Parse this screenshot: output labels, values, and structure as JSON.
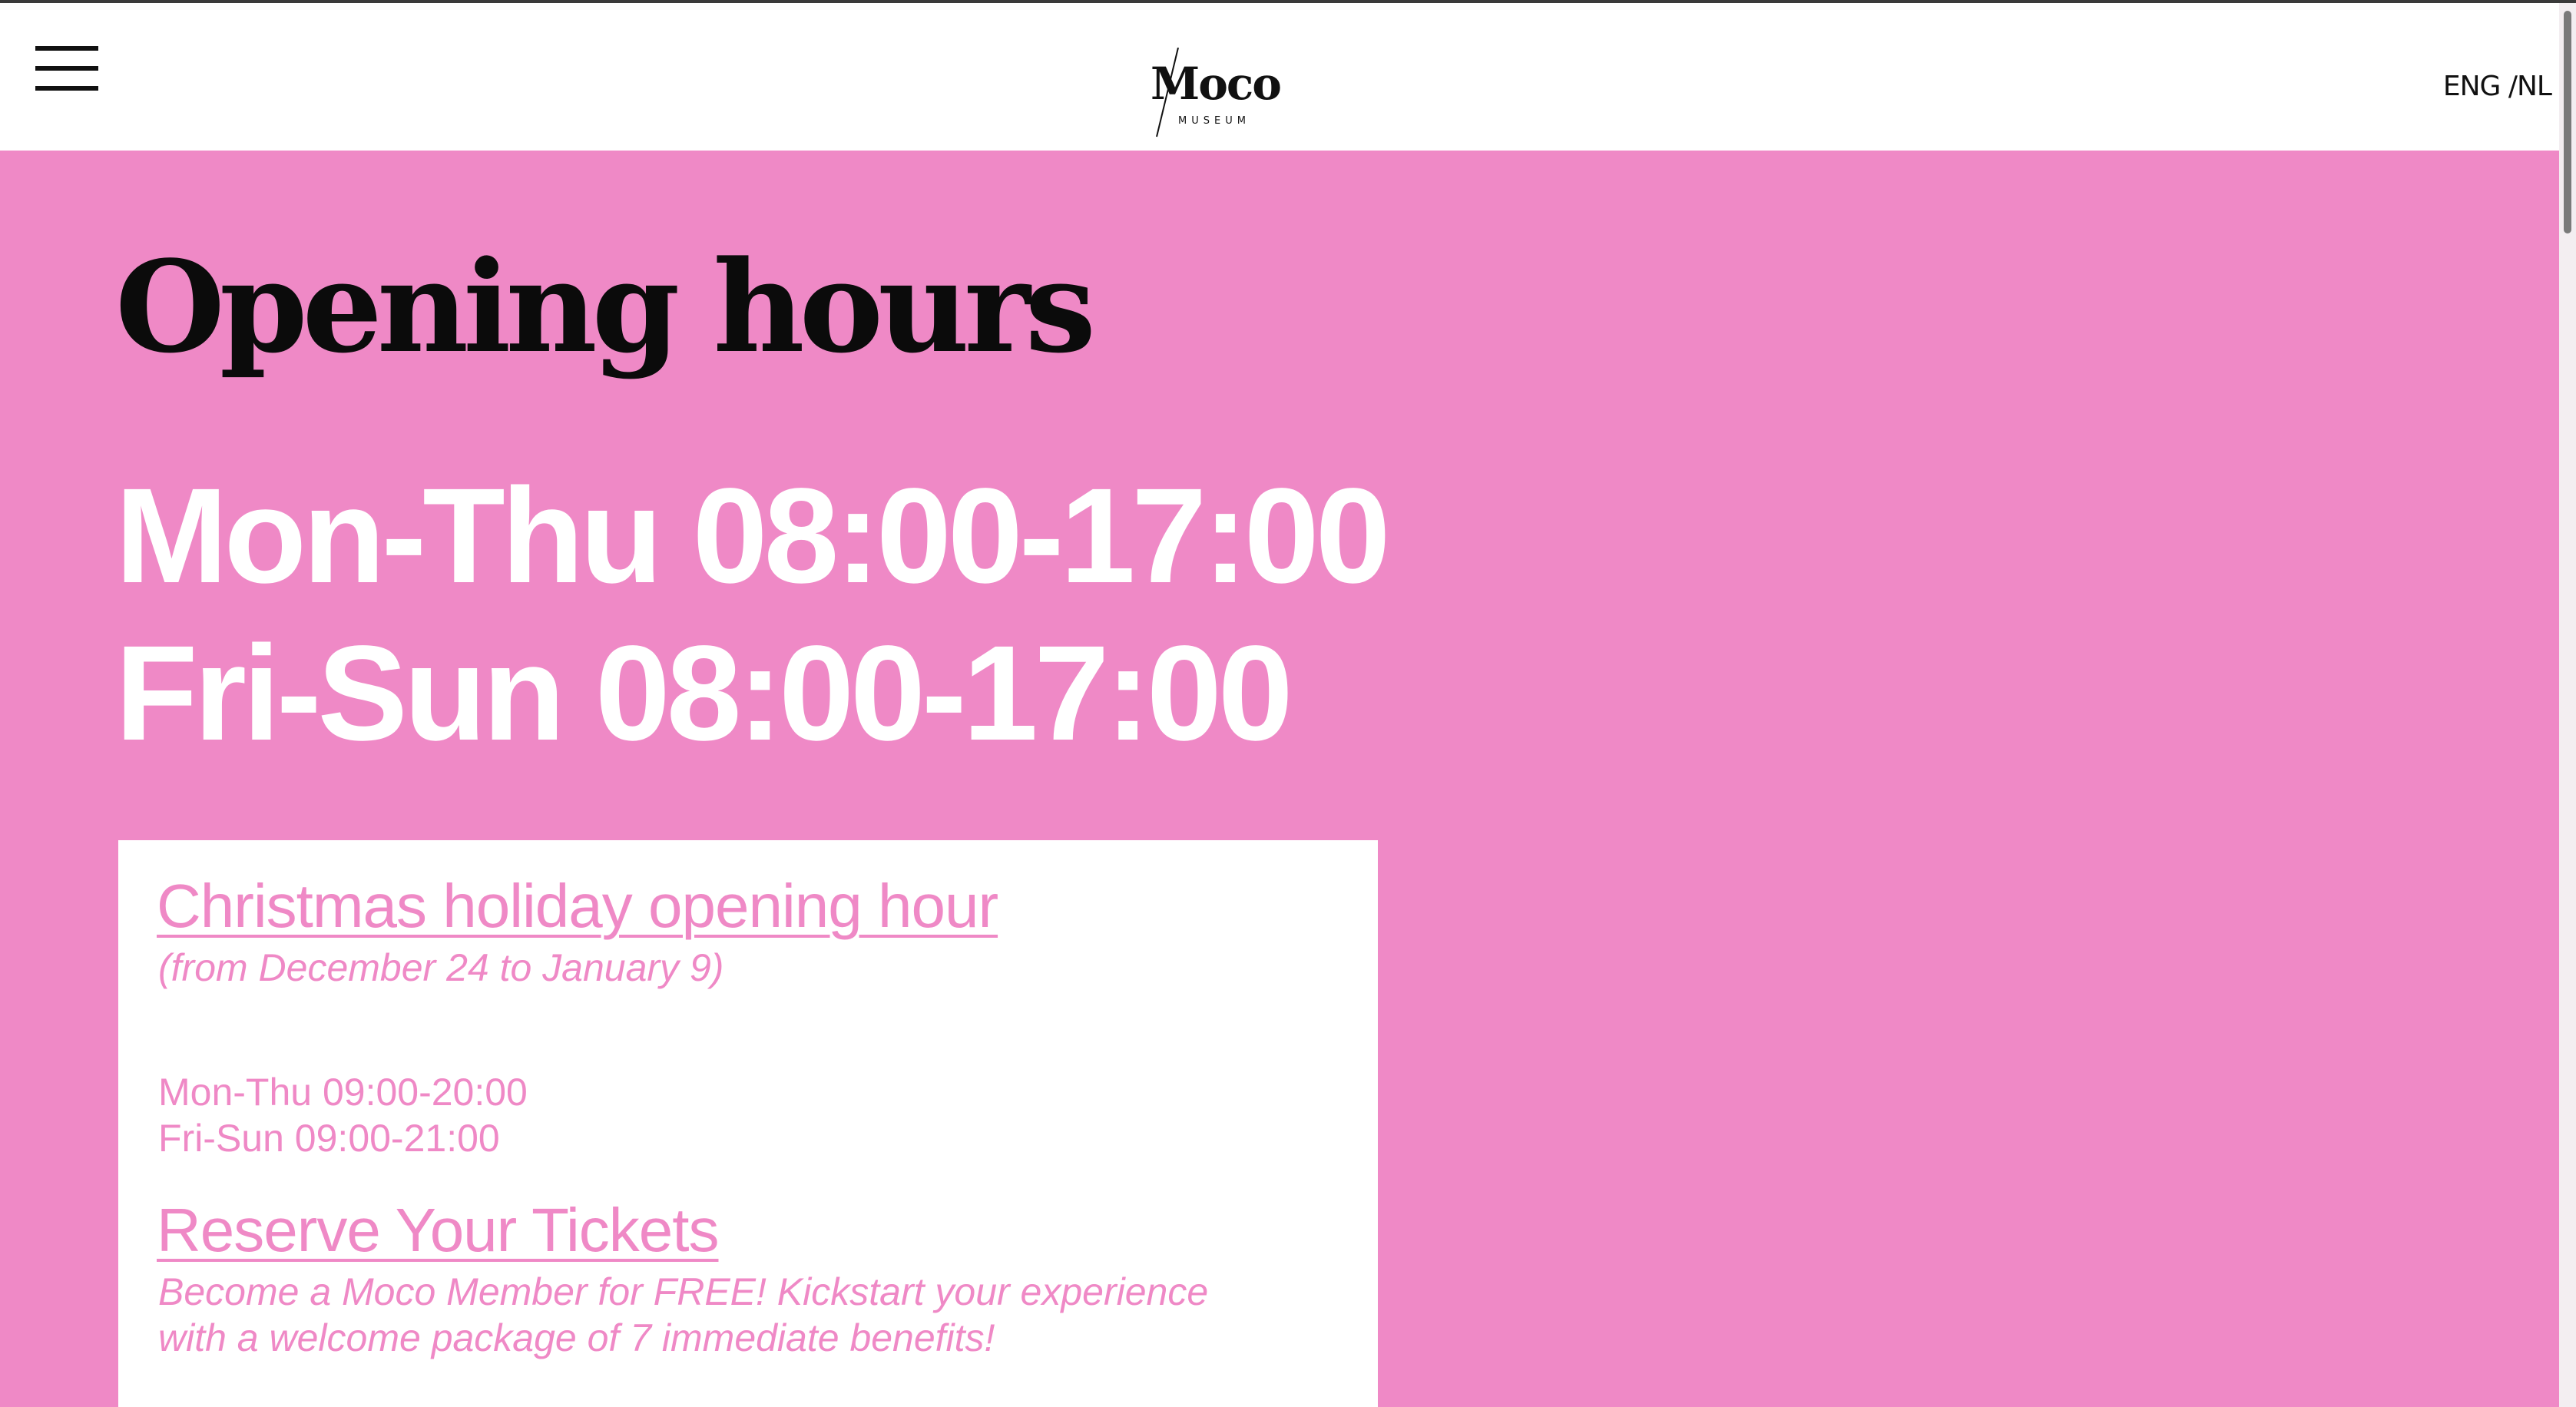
{
  "header": {
    "menu_icon": "hamburger-menu-icon",
    "logo": {
      "name": "Moco",
      "sub": "MUSEUM"
    },
    "language": {
      "english": "ENG",
      "separator": " /",
      "dutch": "NL"
    }
  },
  "main": {
    "title": "Opening hours",
    "hours": [
      "Mon-Thu 08:00-17:00",
      "Fri-Sun 08:00-17:00"
    ]
  },
  "card": {
    "christmas_link": "Christmas holiday opening hour",
    "christmas_range": "(from December 24 to January 9)",
    "christmas_hours": [
      "Mon-Thu 09:00-20:00",
      "Fri-Sun 09:00-21:00"
    ],
    "reserve_link": "Reserve Your Tickets",
    "promo": [
      "Become a Moco Member for FREE! Kickstart your experience",
      "with a welcome package of 7 immediate benefits!"
    ]
  },
  "colors": {
    "background": "#ef89c6",
    "accent_text": "#ef89c6",
    "card_bg": "#ffffff",
    "header_bg": "#ffffff"
  }
}
